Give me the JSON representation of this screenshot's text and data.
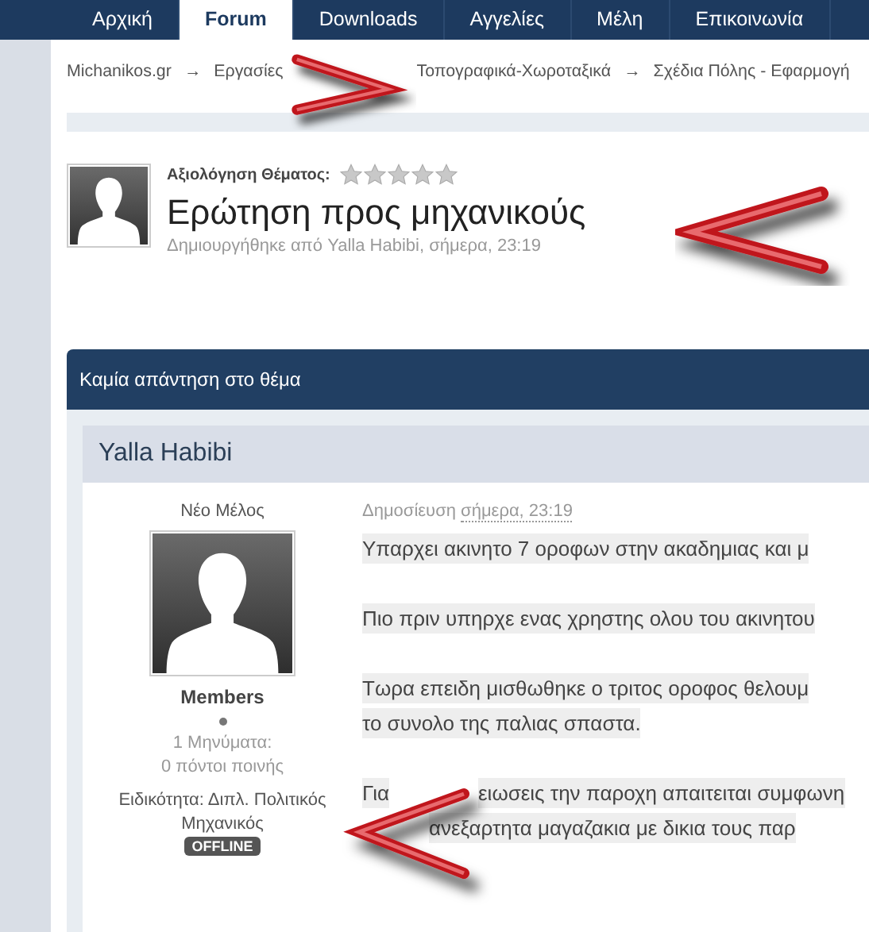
{
  "nav": {
    "tabs": [
      {
        "label": "Αρχική",
        "selected": false
      },
      {
        "label": "Forum",
        "selected": true
      },
      {
        "label": "Downloads",
        "selected": false
      },
      {
        "label": "Αγγελίες",
        "selected": false
      },
      {
        "label": "Μέλη",
        "selected": false
      },
      {
        "label": "Επικοινωνία",
        "selected": false
      }
    ]
  },
  "breadcrumb": [
    {
      "kind": "link",
      "label": "Michanikos.gr"
    },
    {
      "kind": "separator",
      "label": "→"
    },
    {
      "kind": "link",
      "label": "Εργασίες"
    },
    {
      "kind": "arrow"
    },
    {
      "kind": "link",
      "label": "Τοπογραφικά-Χωροταξικά"
    },
    {
      "kind": "separator",
      "label": "→"
    },
    {
      "kind": "link",
      "label": "Σχέδια Πόλης - Εφαρμογή"
    }
  ],
  "topic": {
    "rating_label": "Αξιολόγηση Θέματος:",
    "stars": 0,
    "title": "Ερώτηση προς μηχανικούς",
    "byline": "Δημιουργήθηκε από Yalla Habibi, σήμερα, 23:19"
  },
  "replies_bar": "Καμία απάντηση στο θέμα",
  "post": {
    "author": "Yalla Habibi",
    "rank": "Νέο Μέλος",
    "group": "Members",
    "posts": "1 Μηνύματα:",
    "warn_points": "0 πόντοι ποινής",
    "specialty": "Ειδικότητα: Διπλ. Πολιτικός Μηχανικός",
    "online": false,
    "offline_badge": "OFFLINE",
    "date_label": "Δημοσίευση",
    "date": "σήμερα, 23:19",
    "paragraphs": [
      {
        "kind": "plain",
        "lines": [
          [
            "Υπαρχει ακινητο 7 οροφων στην ακαδημιας και μ"
          ]
        ]
      },
      {
        "kind": "plain",
        "lines": [
          [
            "Πιο πριν υπηρχε ενας χρηστης ολου του ακινητου"
          ]
        ]
      },
      {
        "kind": "plain",
        "lines": [
          [
            "Τωρα επειδη μισθωθηκε ο τριτος οροφος θελουμ"
          ],
          [
            "το συνολο της παλιας σπαστα."
          ]
        ]
      },
      {
        "kind": "arrow",
        "lines": [
          [
            "Για",
            "ειωσεις την παροχη απαιτειται συμφωνη"
          ],
          [
            "ανεξαρτητα μαγαζακια με δικια τους παρ"
          ]
        ]
      }
    ]
  }
}
